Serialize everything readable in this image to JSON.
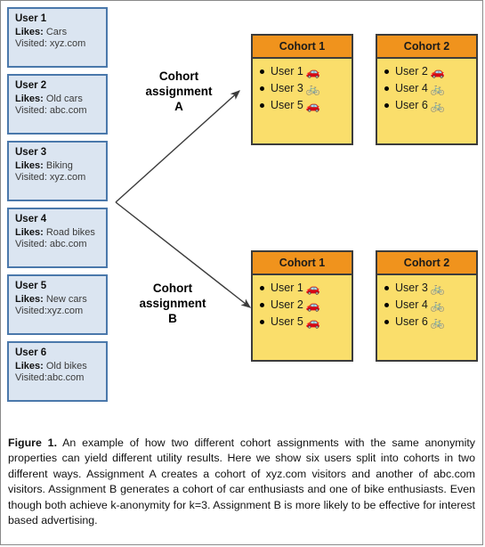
{
  "users": [
    {
      "name": "User 1",
      "likes_label": "Likes:",
      "likes": "Cars",
      "visited": "Visited: xyz.com"
    },
    {
      "name": "User 2",
      "likes_label": "Likes:",
      "likes": "Old cars",
      "visited": "Visited: abc.com"
    },
    {
      "name": "User 3",
      "likes_label": "Likes:",
      "likes": "Biking",
      "visited": "Visited: xyz.com"
    },
    {
      "name": "User 4",
      "likes_label": "Likes:",
      "likes": "Road bikes",
      "visited": "Visited: abc.com"
    },
    {
      "name": "User 5",
      "likes_label": "Likes:",
      "likes": "New cars",
      "visited": "Visited:xyz.com"
    },
    {
      "name": "User 6",
      "likes_label": "Likes:",
      "likes": "Old bikes",
      "visited": "Visited:abc.com"
    }
  ],
  "assignments": {
    "a": {
      "label": "Cohort\nassignment\nA",
      "cohorts": [
        {
          "title": "Cohort 1",
          "members": [
            {
              "name": "User 1",
              "icon": "car-icon",
              "glyph": "🚗"
            },
            {
              "name": "User 3",
              "icon": "bike-icon",
              "glyph": "🚲"
            },
            {
              "name": "User 5",
              "icon": "car-icon",
              "glyph": "🚗"
            }
          ]
        },
        {
          "title": "Cohort 2",
          "members": [
            {
              "name": "User 2",
              "icon": "car-icon",
              "glyph": "🚗"
            },
            {
              "name": "User 4",
              "icon": "bike-icon",
              "glyph": "🚲"
            },
            {
              "name": "User 6",
              "icon": "bike-icon",
              "glyph": "🚲"
            }
          ]
        }
      ]
    },
    "b": {
      "label": "Cohort\nassignment\nB",
      "cohorts": [
        {
          "title": "Cohort 1",
          "members": [
            {
              "name": "User 1",
              "icon": "car-icon",
              "glyph": "🚗"
            },
            {
              "name": "User 2",
              "icon": "car-icon",
              "glyph": "🚗"
            },
            {
              "name": "User 5",
              "icon": "car-icon",
              "glyph": "🚗"
            }
          ]
        },
        {
          "title": "Cohort 2",
          "members": [
            {
              "name": "User 3",
              "icon": "bike-icon",
              "glyph": "🚲"
            },
            {
              "name": "User 4",
              "icon": "bike-icon",
              "glyph": "🚲"
            },
            {
              "name": "User 6",
              "icon": "bike-icon",
              "glyph": "🚲"
            }
          ]
        }
      ]
    }
  },
  "caption": {
    "figure_number": "Figure 1.",
    "text": " An example of how two different cohort assignments with the same anonymity properties can yield different utility results. Here we show six users split into cohorts in two different ways. Assignment A creates a cohort of xyz.com visitors and another of abc.com visitors. Assignment B generates a cohort of car enthusiasts and one of bike enthusiasts. Even though both achieve k-anonymity for k=3. Assignment B is more likely to be effective for interest based advertising."
  },
  "colors": {
    "user_card_fill": "#dbe5f1",
    "user_card_border": "#4a78ab",
    "cohort_header": "#f0931d",
    "cohort_body": "#fade6b",
    "cohort_border": "#3c3c3c",
    "page_border": "#8a8a8a"
  }
}
